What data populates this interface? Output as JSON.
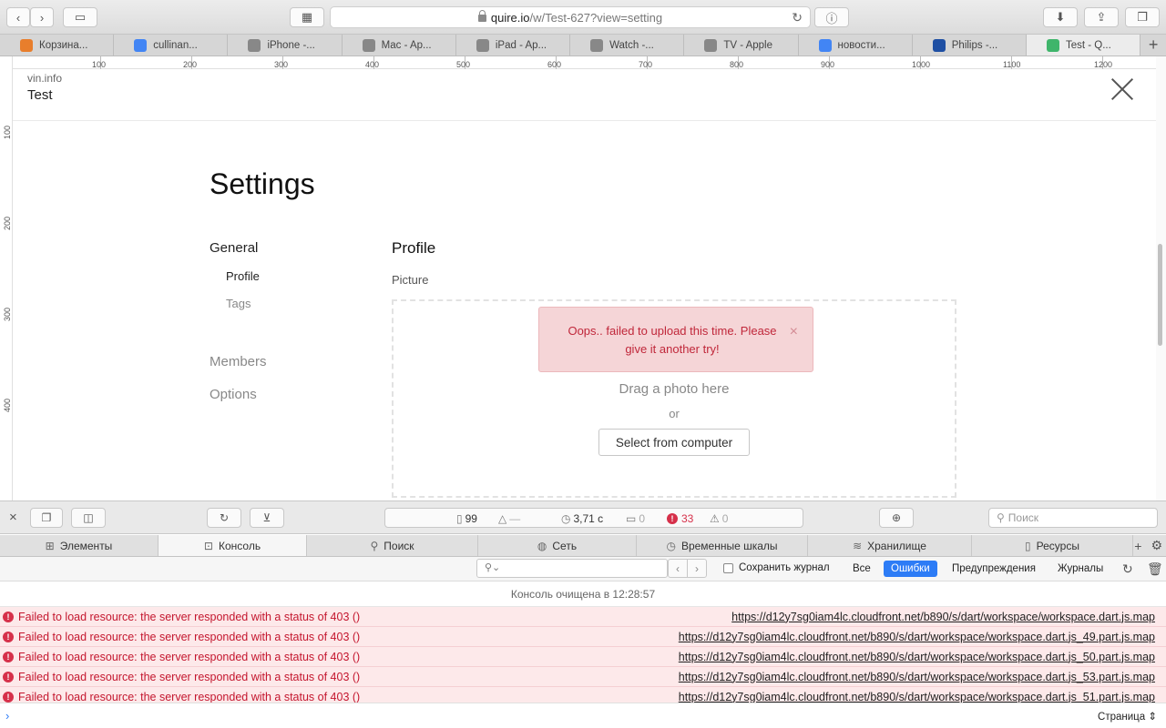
{
  "browser": {
    "url_host": "quire.io",
    "url_path": "/w/Test-627?view=setting",
    "tabs": [
      {
        "label": "Корзина...",
        "icon": "cart-favicon-icon",
        "color": "#e87e2c"
      },
      {
        "label": "cullinan...",
        "icon": "google-favicon-icon",
        "color": "#4285f4"
      },
      {
        "label": "iPhone -...",
        "icon": "apple-favicon-icon",
        "color": "#888888"
      },
      {
        "label": "Mac - Ap...",
        "icon": "apple-favicon-icon",
        "color": "#888888"
      },
      {
        "label": "iPad - Ap...",
        "icon": "apple-favicon-icon",
        "color": "#888888"
      },
      {
        "label": "Watch -...",
        "icon": "apple-favicon-icon",
        "color": "#888888"
      },
      {
        "label": "TV - Apple",
        "icon": "apple-favicon-icon",
        "color": "#888888"
      },
      {
        "label": "новости...",
        "icon": "google-favicon-icon",
        "color": "#4285f4"
      },
      {
        "label": "Philips -...",
        "icon": "philips-favicon-icon",
        "color": "#1e4fa3"
      },
      {
        "label": "Test - Q...",
        "icon": "quire-favicon-icon",
        "color": "#3fb56b"
      }
    ]
  },
  "rulers": {
    "top": [
      "100",
      "200",
      "300",
      "400",
      "500",
      "600",
      "700",
      "800",
      "900",
      "1000",
      "1100",
      "1200"
    ],
    "left": [
      "100",
      "200",
      "300",
      "400"
    ]
  },
  "workspace": {
    "org": "vin.info",
    "name": "Test"
  },
  "settings": {
    "title": "Settings",
    "nav": {
      "general": "General",
      "profile": "Profile",
      "tags": "Tags",
      "members": "Members",
      "options": "Options"
    },
    "section_title": "Profile",
    "picture_label": "Picture",
    "error_message": "Oops.. failed to upload this time. Please give it another try!",
    "error_close": "×",
    "drag_text": "Drag a photo here",
    "or_text": "or",
    "select_button": "Select from computer"
  },
  "inspector": {
    "metrics": {
      "resources": "99",
      "size": "—",
      "load_time": "3,71 с",
      "logs": "0",
      "errors": "33",
      "warnings": "0"
    },
    "search_placeholder": "Поиск",
    "tabs": [
      {
        "label": "Элементы",
        "icon": "elements-icon"
      },
      {
        "label": "Консоль",
        "icon": "console-icon"
      },
      {
        "label": "Поиск",
        "icon": "search-icon"
      },
      {
        "label": "Сеть",
        "icon": "network-icon"
      },
      {
        "label": "Временные шкалы",
        "icon": "timeline-icon"
      },
      {
        "label": "Хранилище",
        "icon": "storage-icon"
      },
      {
        "label": "Ресурсы",
        "icon": "resources-icon"
      }
    ],
    "active_tab": "Консоль",
    "filters": {
      "preserve_log": "Сохранить журнал",
      "all": "Все",
      "errors": "Ошибки",
      "warnings": "Предупреждения",
      "logs": "Журналы"
    },
    "console": {
      "cleared": "Консоль очищена в 12:28:57",
      "messages": [
        {
          "text": "Failed to load resource: the server responded with a status of 403 ()",
          "source": "https://d12y7sg0iam4lc.cloudfront.net/b890/s/dart/workspace/workspace.dart.js.map"
        },
        {
          "text": "Failed to load resource: the server responded with a status of 403 ()",
          "source": "https://d12y7sg0iam4lc.cloudfront.net/b890/s/dart/workspace/workspace.dart.js_49.part.js.map"
        },
        {
          "text": "Failed to load resource: the server responded with a status of 403 ()",
          "source": "https://d12y7sg0iam4lc.cloudfront.net/b890/s/dart/workspace/workspace.dart.js_50.part.js.map"
        },
        {
          "text": "Failed to load resource: the server responded with a status of 403 ()",
          "source": "https://d12y7sg0iam4lc.cloudfront.net/b890/s/dart/workspace/workspace.dart.js_53.part.js.map"
        },
        {
          "text": "Failed to load resource: the server responded with a status of 403 ()",
          "source": "https://d12y7sg0iam4lc.cloudfront.net/b890/s/dart/workspace/workspace.dart.js_51.part.js.map"
        }
      ],
      "context": "Страница"
    }
  },
  "colors": {
    "error_red": "#d6304a",
    "active_filter": "#2d7cf6",
    "error_bg": "#f5d5d7"
  }
}
